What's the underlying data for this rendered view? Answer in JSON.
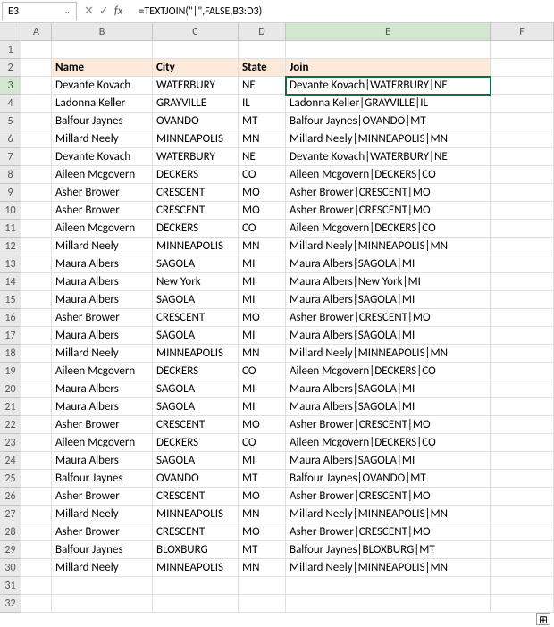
{
  "namebox": {
    "ref": "E3",
    "chev": "⌄"
  },
  "formula": "=TEXTJOIN(\"|\",FALSE,B3:D3)",
  "fx_label": "fx",
  "cols": [
    "A",
    "B",
    "C",
    "D",
    "E",
    "F"
  ],
  "header_row": [
    "",
    "Name",
    "City",
    "State",
    "Join",
    ""
  ],
  "rows": [
    {
      "n": 1,
      "a": "",
      "b": "",
      "c": "",
      "d": "",
      "e": "",
      "f": ""
    },
    {
      "n": 2,
      "a": "",
      "b": "Name",
      "c": "City",
      "d": "State",
      "e": "Join",
      "f": "",
      "hdr": true
    },
    {
      "n": 3,
      "a": "",
      "b": "Devante Kovach",
      "c": "WATERBURY",
      "d": "NE",
      "e": "Devante Kovach|WATERBURY|NE",
      "f": "",
      "sel": true
    },
    {
      "n": 4,
      "a": "",
      "b": "Ladonna Keller",
      "c": "GRAYVILLE",
      "d": "IL",
      "e": "Ladonna Keller|GRAYVILLE|IL",
      "f": ""
    },
    {
      "n": 5,
      "a": "",
      "b": "Balfour Jaynes",
      "c": "OVANDO",
      "d": "MT",
      "e": "Balfour Jaynes|OVANDO|MT",
      "f": ""
    },
    {
      "n": 6,
      "a": "",
      "b": "Millard Neely",
      "c": "MINNEAPOLIS",
      "d": "MN",
      "e": "Millard Neely|MINNEAPOLIS|MN",
      "f": ""
    },
    {
      "n": 7,
      "a": "",
      "b": "Devante Kovach",
      "c": "WATERBURY",
      "d": "NE",
      "e": "Devante Kovach|WATERBURY|NE",
      "f": ""
    },
    {
      "n": 8,
      "a": "",
      "b": "Aileen Mcgovern",
      "c": "DECKERS",
      "d": "CO",
      "e": "Aileen Mcgovern|DECKERS|CO",
      "f": ""
    },
    {
      "n": 9,
      "a": "",
      "b": "Asher Brower",
      "c": "CRESCENT",
      "d": "MO",
      "e": "Asher Brower|CRESCENT|MO",
      "f": ""
    },
    {
      "n": 10,
      "a": "",
      "b": "Asher Brower",
      "c": "CRESCENT",
      "d": "MO",
      "e": "Asher Brower|CRESCENT|MO",
      "f": ""
    },
    {
      "n": 11,
      "a": "",
      "b": "Aileen Mcgovern",
      "c": "DECKERS",
      "d": "CO",
      "e": "Aileen Mcgovern|DECKERS|CO",
      "f": ""
    },
    {
      "n": 12,
      "a": "",
      "b": "Millard Neely",
      "c": "MINNEAPOLIS",
      "d": "MN",
      "e": "Millard Neely|MINNEAPOLIS|MN",
      "f": ""
    },
    {
      "n": 13,
      "a": "",
      "b": "Maura Albers",
      "c": "SAGOLA",
      "d": "MI",
      "e": "Maura Albers|SAGOLA|MI",
      "f": ""
    },
    {
      "n": 14,
      "a": "",
      "b": "Maura Albers",
      "c": "New York",
      "d": "MI",
      "e": "Maura Albers|New York|MI",
      "f": ""
    },
    {
      "n": 15,
      "a": "",
      "b": "Maura Albers",
      "c": "SAGOLA",
      "d": "MI",
      "e": "Maura Albers|SAGOLA|MI",
      "f": ""
    },
    {
      "n": 16,
      "a": "",
      "b": "Asher Brower",
      "c": "CRESCENT",
      "d": "MO",
      "e": "Asher Brower|CRESCENT|MO",
      "f": ""
    },
    {
      "n": 17,
      "a": "",
      "b": "Maura Albers",
      "c": "SAGOLA",
      "d": "MI",
      "e": "Maura Albers|SAGOLA|MI",
      "f": ""
    },
    {
      "n": 18,
      "a": "",
      "b": "Millard Neely",
      "c": "MINNEAPOLIS",
      "d": "MN",
      "e": "Millard Neely|MINNEAPOLIS|MN",
      "f": ""
    },
    {
      "n": 19,
      "a": "",
      "b": "Aileen Mcgovern",
      "c": "DECKERS",
      "d": "CO",
      "e": "Aileen Mcgovern|DECKERS|CO",
      "f": ""
    },
    {
      "n": 20,
      "a": "",
      "b": "Maura Albers",
      "c": "SAGOLA",
      "d": "MI",
      "e": "Maura Albers|SAGOLA|MI",
      "f": ""
    },
    {
      "n": 21,
      "a": "",
      "b": "Maura Albers",
      "c": "SAGOLA",
      "d": "MI",
      "e": "Maura Albers|SAGOLA|MI",
      "f": ""
    },
    {
      "n": 22,
      "a": "",
      "b": "Asher Brower",
      "c": "CRESCENT",
      "d": "MO",
      "e": "Asher Brower|CRESCENT|MO",
      "f": ""
    },
    {
      "n": 23,
      "a": "",
      "b": "Aileen Mcgovern",
      "c": "DECKERS",
      "d": "CO",
      "e": "Aileen Mcgovern|DECKERS|CO",
      "f": ""
    },
    {
      "n": 24,
      "a": "",
      "b": "Maura Albers",
      "c": "SAGOLA",
      "d": "MI",
      "e": "Maura Albers|SAGOLA|MI",
      "f": ""
    },
    {
      "n": 25,
      "a": "",
      "b": "Balfour Jaynes",
      "c": "OVANDO",
      "d": "MT",
      "e": "Balfour Jaynes|OVANDO|MT",
      "f": ""
    },
    {
      "n": 26,
      "a": "",
      "b": "Asher Brower",
      "c": "CRESCENT",
      "d": "MO",
      "e": "Asher Brower|CRESCENT|MO",
      "f": ""
    },
    {
      "n": 27,
      "a": "",
      "b": "Millard Neely",
      "c": "MINNEAPOLIS",
      "d": "MN",
      "e": "Millard Neely|MINNEAPOLIS|MN",
      "f": ""
    },
    {
      "n": 28,
      "a": "",
      "b": "Asher Brower",
      "c": "CRESCENT",
      "d": "MO",
      "e": "Asher Brower|CRESCENT|MO",
      "f": ""
    },
    {
      "n": 29,
      "a": "",
      "b": "Balfour Jaynes",
      "c": "BLOXBURG",
      "d": "MT",
      "e": "Balfour Jaynes|BLOXBURG|MT",
      "f": ""
    },
    {
      "n": 30,
      "a": "",
      "b": "Millard Neely",
      "c": "MINNEAPOLIS",
      "d": "MN",
      "e": "Millard Neely|MINNEAPOLIS|MN",
      "f": ""
    },
    {
      "n": 31,
      "a": "",
      "b": "",
      "c": "",
      "d": "",
      "e": "",
      "f": ""
    },
    {
      "n": 32,
      "a": "",
      "b": "",
      "c": "",
      "d": "",
      "e": "",
      "f": ""
    }
  ],
  "autofill_glyph": "⊞",
  "selected_col": "E",
  "selected_row": 3
}
